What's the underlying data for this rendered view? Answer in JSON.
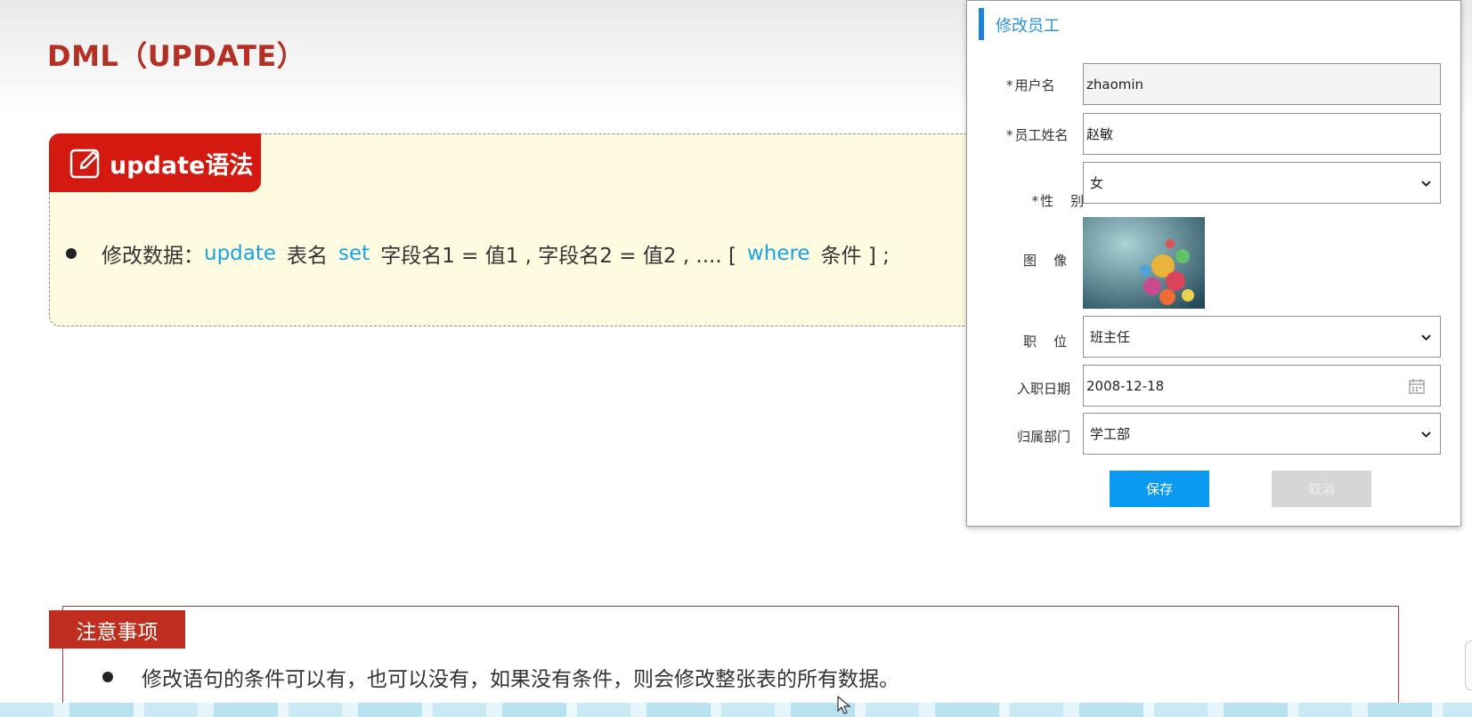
{
  "slide": {
    "title": "DML（UPDATE）",
    "syntax": {
      "tag_label": "update语法",
      "line": {
        "prefix": "修改数据：",
        "kw_update": "update",
        "table": "表名",
        "kw_set": "set",
        "assignments": "字段名1 = 值1 , 字段名2 = 值2 , .... [",
        "kw_where": "where",
        "suffix": "条件 ] ;"
      }
    },
    "notes": {
      "tag_label": "注意事项",
      "line": "修改语句的条件可以有，也可以没有，如果没有条件，则会修改整张表的所有数据。"
    }
  },
  "dialog": {
    "title": "修改员工",
    "fields": {
      "username": {
        "required": "*",
        "label": "用户名",
        "value": "zhaomin"
      },
      "name": {
        "required": "*",
        "label": "员工姓名",
        "value": "赵敏"
      },
      "gender": {
        "required": "*",
        "label": "性    别",
        "value": "女"
      },
      "image": {
        "label": "图    像"
      },
      "job": {
        "label": "职    位",
        "value": "班主任"
      },
      "entry_date": {
        "label": "入职日期",
        "value": "2008-12-18"
      },
      "dept": {
        "label": "归属部门",
        "value": "学工部"
      }
    },
    "buttons": {
      "save": "保存",
      "cancel": "取消"
    }
  },
  "colors": {
    "title_red": "#b43024",
    "tag_red": "#d41a10",
    "keyword_blue": "#17a3e0",
    "primary_blue": "#0a9af2",
    "dialog_accent": "#1a82e0"
  },
  "icons": [
    "edit-icon",
    "chevron-down-icon",
    "calendar-icon",
    "cursor-icon"
  ]
}
